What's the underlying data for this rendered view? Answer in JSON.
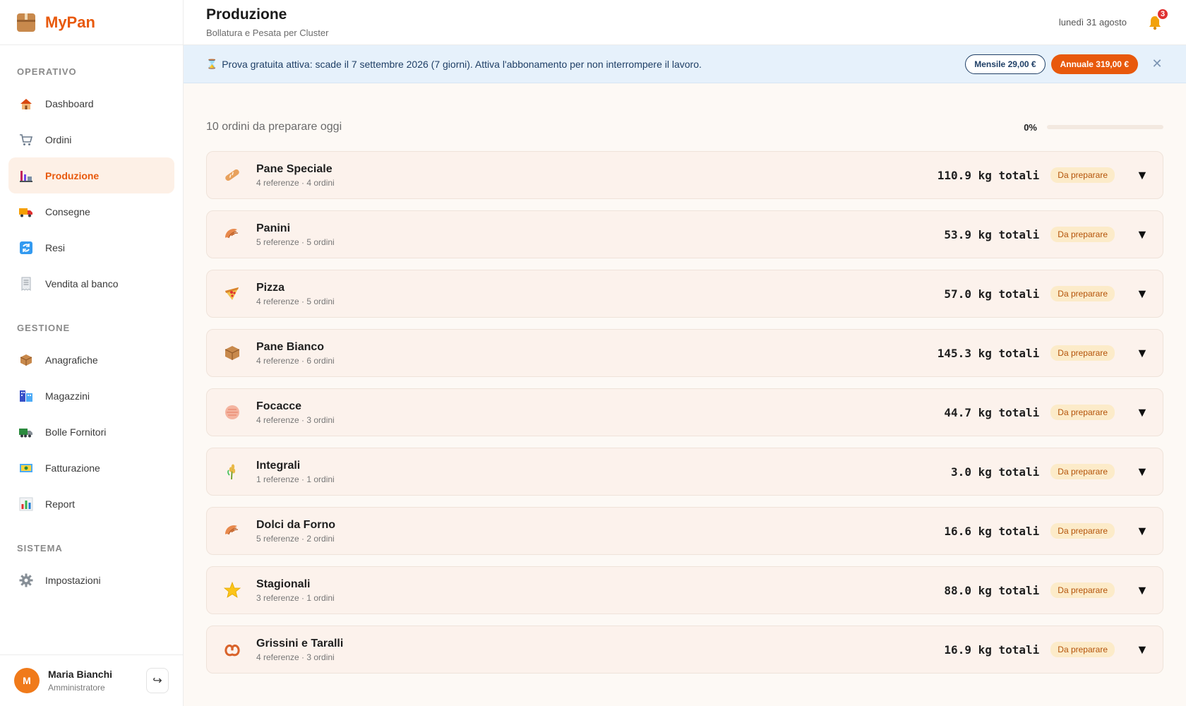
{
  "app": {
    "brand": "MyPan",
    "brand_color": "#e8590c"
  },
  "sidebar": {
    "sections": [
      {
        "title": "OPERATIVO",
        "items": [
          {
            "label": "Dashboard",
            "icon": "house-icon",
            "active": false
          },
          {
            "label": "Ordini",
            "icon": "cart-icon",
            "active": false
          },
          {
            "label": "Produzione",
            "icon": "factory-icon",
            "active": true
          },
          {
            "label": "Consegne",
            "icon": "truck-icon",
            "active": false
          },
          {
            "label": "Resi",
            "icon": "refresh-icon",
            "active": false
          },
          {
            "label": "Vendita al banco",
            "icon": "receipt-icon",
            "active": false
          }
        ]
      },
      {
        "title": "GESTIONE",
        "items": [
          {
            "label": "Anagrafiche",
            "icon": "box-icon",
            "active": false
          },
          {
            "label": "Magazzini",
            "icon": "warehouse-icon",
            "active": false
          },
          {
            "label": "Bolle Fornitori",
            "icon": "lorry-icon",
            "active": false
          },
          {
            "label": "Fatturazione",
            "icon": "banknote-icon",
            "active": false
          },
          {
            "label": "Report",
            "icon": "bar-chart-icon",
            "active": false
          }
        ]
      },
      {
        "title": "SISTEMA",
        "items": [
          {
            "label": "Impostazioni",
            "icon": "gear-icon",
            "active": false
          }
        ]
      }
    ],
    "user": {
      "initial": "M",
      "name": "Maria Bianchi",
      "role": "Amministratore"
    }
  },
  "header": {
    "title": "Produzione",
    "subtitle": "Bollatura e Pesata per Cluster",
    "date": "lunedì 31 agosto",
    "notifications": "3"
  },
  "trial": {
    "text": "Prova gratuita attiva: scade il 7 settembre 2026 (7 giorni). Attiva l'abbonamento per non interrompere il lavoro.",
    "monthly": "Mensile 29,00 €",
    "yearly": "Annuale 319,00 €"
  },
  "summary": {
    "text": "10 ordini da preparare oggi",
    "progress_label": "0%",
    "progress_percent": 0
  },
  "clusters": [
    {
      "name": "Pane Speciale",
      "meta": "4 referenze · 4 ordini",
      "weight": "110.9 kg totali",
      "status": "Da preparare",
      "icon": "baguette-icon"
    },
    {
      "name": "Panini",
      "meta": "5 referenze · 5 ordini",
      "weight": "53.9 kg totali",
      "status": "Da preparare",
      "icon": "croissant-icon"
    },
    {
      "name": "Pizza",
      "meta": "4 referenze · 5 ordini",
      "weight": "57.0 kg totali",
      "status": "Da preparare",
      "icon": "pizza-icon"
    },
    {
      "name": "Pane Bianco",
      "meta": "4 referenze · 6 ordini",
      "weight": "145.3 kg totali",
      "status": "Da preparare",
      "icon": "box-icon"
    },
    {
      "name": "Focacce",
      "meta": "4 referenze · 3 ordini",
      "weight": "44.7 kg totali",
      "status": "Da preparare",
      "icon": "flatbread-icon"
    },
    {
      "name": "Integrali",
      "meta": "1 referenze · 1 ordini",
      "weight": "3.0 kg totali",
      "status": "Da preparare",
      "icon": "wheat-icon"
    },
    {
      "name": "Dolci da Forno",
      "meta": "5 referenze · 2 ordini",
      "weight": "16.6 kg totali",
      "status": "Da preparare",
      "icon": "croissant-icon"
    },
    {
      "name": "Stagionali",
      "meta": "3 referenze · 1 ordini",
      "weight": "88.0 kg totali",
      "status": "Da preparare",
      "icon": "star-icon"
    },
    {
      "name": "Grissini e Taralli",
      "meta": "4 referenze · 3 ordini",
      "weight": "16.9 kg totali",
      "status": "Da preparare",
      "icon": "pretzel-icon"
    }
  ]
}
